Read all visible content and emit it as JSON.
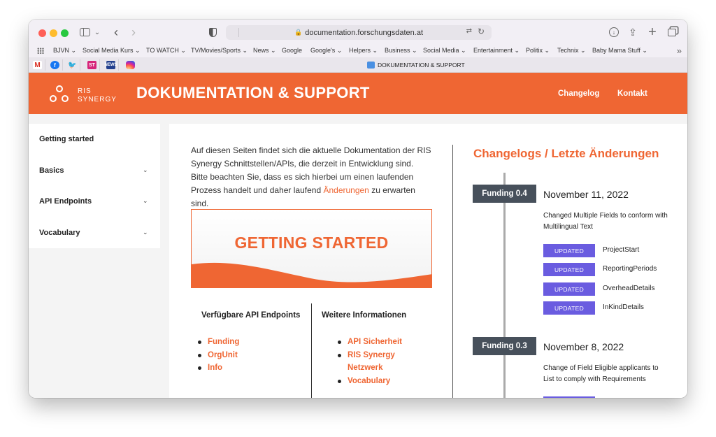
{
  "browser": {
    "address": "documentation.forschungsdaten.at",
    "active_tab_title": "DOKUMENTATION & SUPPORT",
    "bookmarks": [
      {
        "label": "BJVN",
        "menu": true
      },
      {
        "label": "Social Media Kurs",
        "menu": true
      },
      {
        "label": "TO WATCH",
        "menu": true
      },
      {
        "label": "TV/Movies/Sports",
        "menu": true
      },
      {
        "label": "News",
        "menu": true
      },
      {
        "label": "Google",
        "menu": false
      },
      {
        "label": "Google's",
        "menu": true
      },
      {
        "label": "Helpers",
        "menu": true
      },
      {
        "label": "Business",
        "menu": true
      },
      {
        "label": "Social Media",
        "menu": true
      },
      {
        "label": "Entertainment",
        "menu": true
      },
      {
        "label": "Politix",
        "menu": true
      },
      {
        "label": "Technix",
        "menu": true
      },
      {
        "label": "Baby Mama Stuff",
        "menu": true
      }
    ],
    "pinned_tabs": [
      "M",
      "f",
      "🐦",
      "ST",
      "NEWS",
      ""
    ]
  },
  "site": {
    "logo_line1": "RIS",
    "logo_line2": "SYNERGY",
    "title": "DOKUMENTATION & SUPPORT",
    "nav": [
      "Changelog",
      "Kontakt"
    ]
  },
  "sidebar": {
    "items": [
      {
        "label": "Getting started",
        "expandable": false
      },
      {
        "label": "Basics",
        "expandable": true
      },
      {
        "label": "API Endpoints",
        "expandable": true
      },
      {
        "label": "Vocabulary",
        "expandable": true
      }
    ]
  },
  "main": {
    "intro_before": "Auf diesen Seiten findet sich die aktuelle Dokumentation der RIS Synergy Schnittstellen/APIs, die derzeit in Entwicklung sind. Bitte beachten Sie, dass es sich hierbei um einen laufenden Prozess handelt und daher laufend ",
    "intro_link": "Änderungen",
    "intro_after": " zu erwarten sind.",
    "banner_title": "GETTING STARTED",
    "endpoints_heading": "Verfügbare API Endpoints",
    "endpoints": [
      "Funding",
      "OrgUnit",
      "Info"
    ],
    "info_heading": "Weitere Informationen",
    "info_links": [
      "API Sicherheit",
      "RIS Synergy Netzwerk",
      "Vocabulary"
    ]
  },
  "changelog": {
    "title": "Changelogs / Letzte Änderungen",
    "entries": [
      {
        "version": "Funding 0.4",
        "date": "November 11, 2022",
        "description": "Changed Multiple Fields to conform with Multilingual Text",
        "changes": [
          {
            "badge": "UPDATED",
            "field": "ProjectStart"
          },
          {
            "badge": "UPDATED",
            "field": "ReportingPeriods"
          },
          {
            "badge": "UPDATED",
            "field": "OverheadDetails"
          },
          {
            "badge": "UPDATED",
            "field": "InKindDetails"
          }
        ]
      },
      {
        "version": "Funding 0.3",
        "date": "November 8, 2022",
        "description": "Change of Field Eligible applicants to List to comply with Requirements",
        "changes": [
          {
            "badge": "",
            "field": ""
          }
        ]
      }
    ]
  },
  "colors": {
    "brand_orange": "#ef6633",
    "badge_dark": "#47505b",
    "updated_purple": "#6a5ce0"
  }
}
